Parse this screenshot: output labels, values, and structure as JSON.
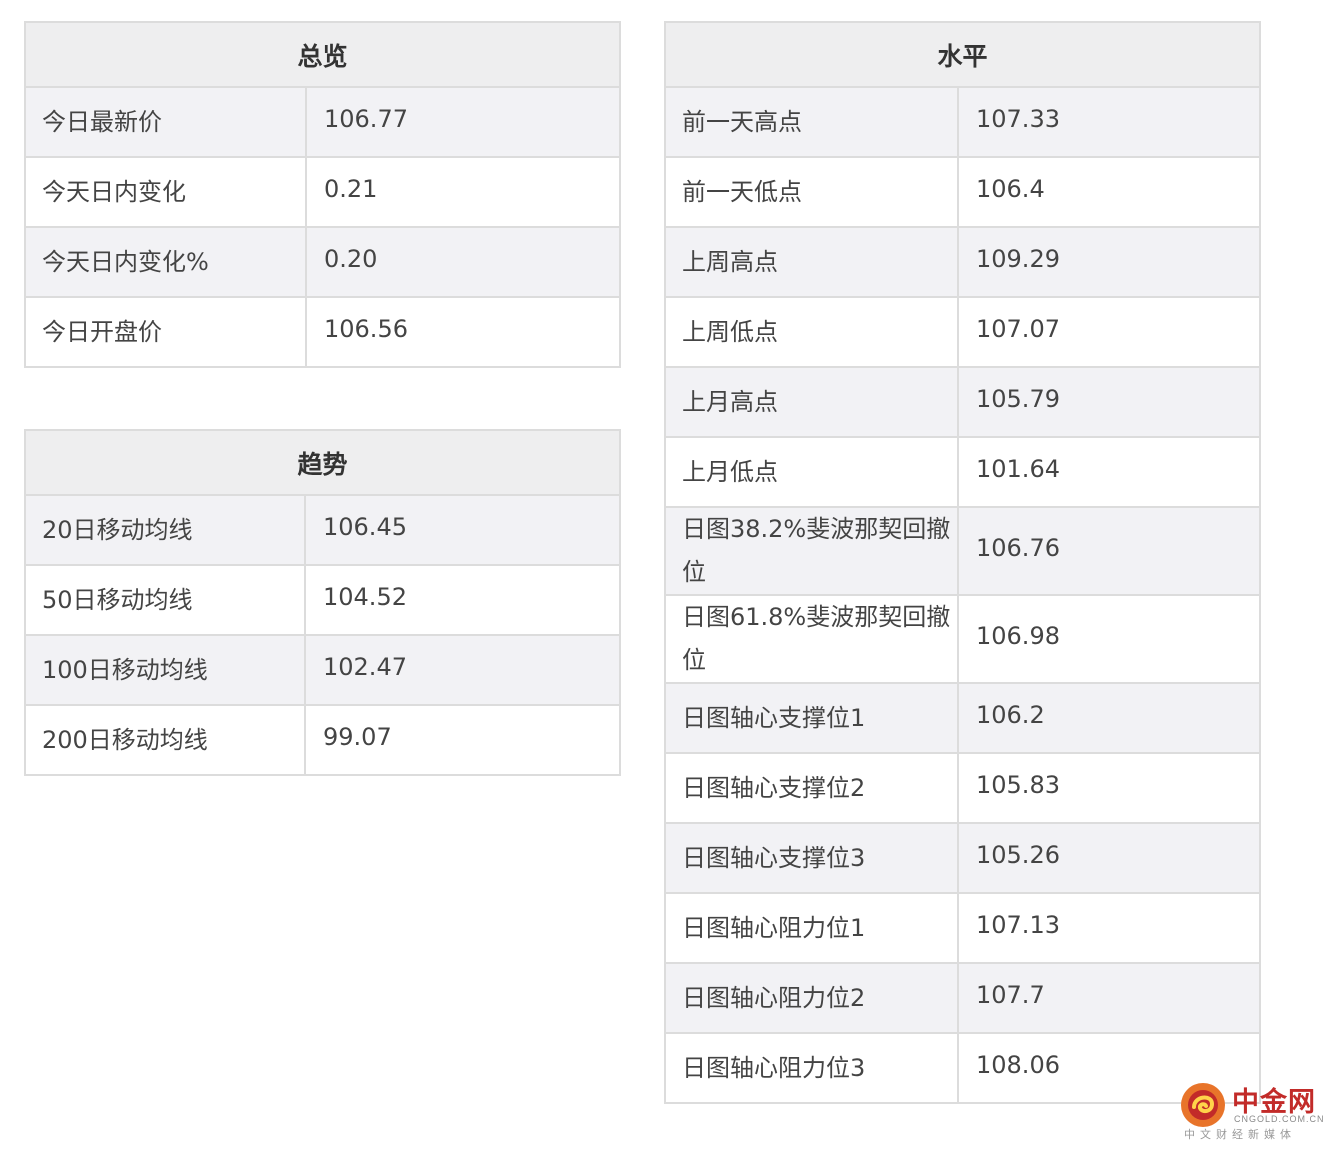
{
  "overview": {
    "title": "总览",
    "rows": [
      {
        "label": "今日最新价",
        "value": "106.77"
      },
      {
        "label": "今天日内变化",
        "value": "0.21"
      },
      {
        "label": "今天日内变化%",
        "value": "0.20"
      },
      {
        "label": "今日开盘价",
        "value": "106.56"
      }
    ]
  },
  "trend": {
    "title": "趋势",
    "rows": [
      {
        "label": "20日移动均线",
        "value": "106.45"
      },
      {
        "label": "50日移动均线",
        "value": "104.52"
      },
      {
        "label": "100日移动均线",
        "value": "102.47"
      },
      {
        "label": "200日移动均线",
        "value": "99.07"
      }
    ]
  },
  "levels": {
    "title": "水平",
    "rows": [
      {
        "label": "前一天高点",
        "value": "107.33"
      },
      {
        "label": "前一天低点",
        "value": "106.4"
      },
      {
        "label": "上周高点",
        "value": "109.29"
      },
      {
        "label": "上周低点",
        "value": "107.07"
      },
      {
        "label": "上月高点",
        "value": "105.79"
      },
      {
        "label": "上月低点",
        "value": "101.64"
      },
      {
        "label": "日图38.2%斐波那契回撤位",
        "value": "106.76"
      },
      {
        "label": "日图61.8%斐波那契回撤位",
        "value": "106.98"
      },
      {
        "label": "日图轴心支撑位1",
        "value": "106.2"
      },
      {
        "label": "日图轴心支撑位2",
        "value": "105.83"
      },
      {
        "label": "日图轴心支撑位3",
        "value": "105.26"
      },
      {
        "label": "日图轴心阻力位1",
        "value": "107.13"
      },
      {
        "label": "日图轴心阻力位2",
        "value": "107.7"
      },
      {
        "label": "日图轴心阻力位3",
        "value": "108.06"
      }
    ]
  },
  "watermark": {
    "name": "中金网",
    "domain": "CNGOLD.COM.CN",
    "slogan": "中文财经新媒体",
    "logo_icon": "cngold-logo-icon",
    "brand_color": "#c22b29",
    "logo_color": "#e8742a"
  },
  "colors": {
    "header_bg": "#eeeeef",
    "striped_row_bg": "#f2f2f5",
    "border": "#dcdcdc"
  }
}
